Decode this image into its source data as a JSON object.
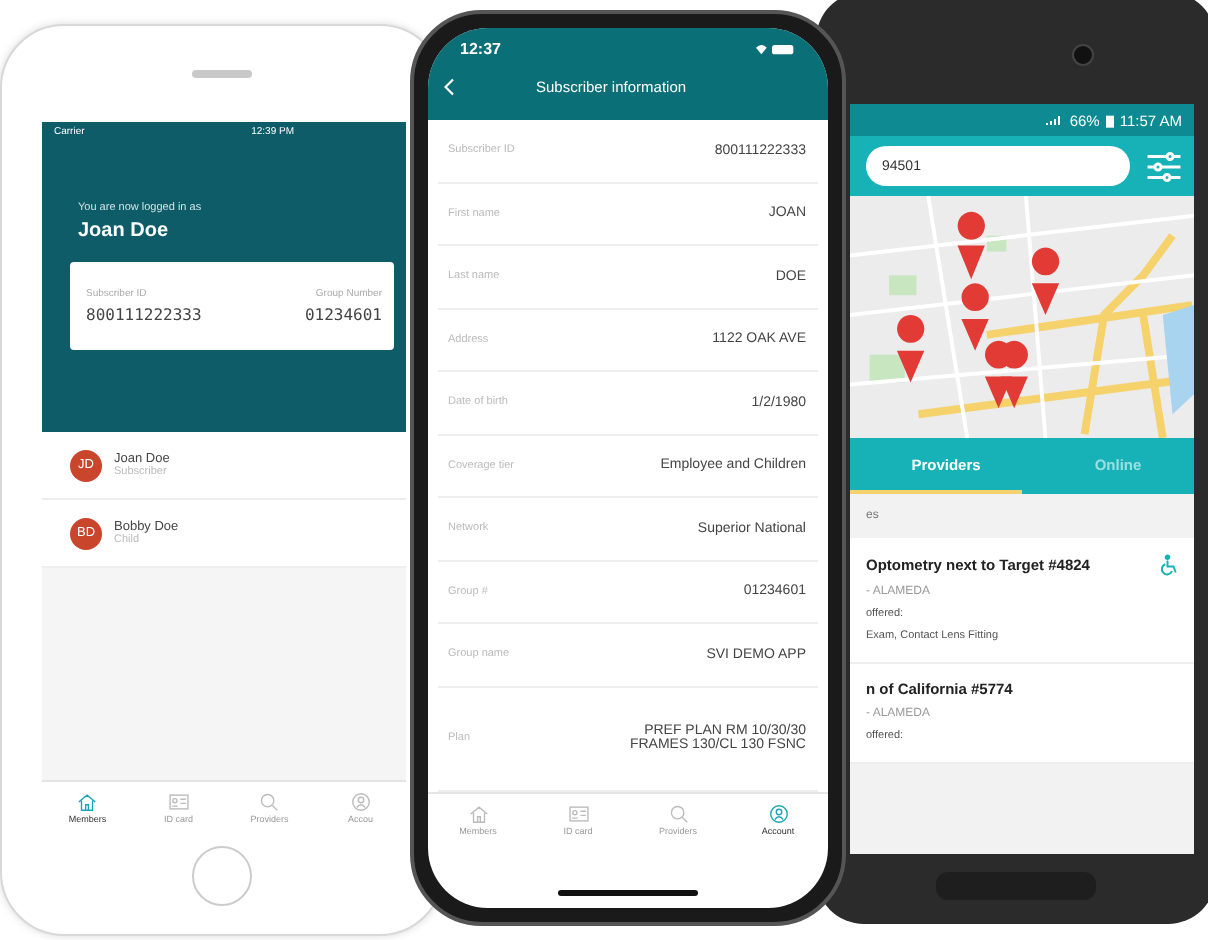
{
  "members_phone": {
    "status_bar": {
      "carrier": "Carrier",
      "time": "12:39 PM"
    },
    "greeting": "You are now logged in as",
    "user_name": "Joan Doe",
    "card_fields": [
      {
        "label": "Subscriber ID",
        "value": "800111222333"
      },
      {
        "label": "Group Number",
        "value": "01234601"
      }
    ],
    "members": [
      {
        "initials": "JD",
        "name": "Joan Doe",
        "role": "Subscriber"
      },
      {
        "initials": "BD",
        "name": "Bobby Doe",
        "role": "Child"
      }
    ],
    "tabs": [
      {
        "kind": "home",
        "label": "Members",
        "selected": true
      },
      {
        "kind": "card",
        "label": "ID card",
        "selected": false
      },
      {
        "kind": "search",
        "label": "Providers",
        "selected": false
      },
      {
        "kind": "account",
        "label": "Accou",
        "selected": false
      }
    ]
  },
  "subscriber_phone": {
    "status_bar": {
      "time": "12:37"
    },
    "title": "Subscriber information",
    "rows": [
      {
        "label": "Subscriber ID",
        "value": "800111222333"
      },
      {
        "label": "First name",
        "value": "JOAN"
      },
      {
        "label": "Last name",
        "value": "DOE"
      },
      {
        "label": "Address",
        "value": "1122 OAK AVE"
      },
      {
        "label": "Date of birth",
        "value": "1/2/1980"
      },
      {
        "label": "Coverage tier",
        "value": "Employee and Children"
      },
      {
        "label": "Network",
        "value": "Superior National"
      },
      {
        "label": "Group #",
        "value": "01234601"
      },
      {
        "label": "Group name",
        "value": "SVI DEMO APP"
      },
      {
        "label": "Plan",
        "value": "PREF PLAN RM 10/30/30 FRAMES 130/CL 130 FSNC"
      }
    ],
    "tabs": [
      {
        "kind": "home",
        "label": "Members",
        "selected": false
      },
      {
        "kind": "card",
        "label": "ID card",
        "selected": false
      },
      {
        "kind": "search",
        "label": "Providers",
        "selected": false
      },
      {
        "kind": "account",
        "label": "Account",
        "selected": true
      }
    ]
  },
  "providers_phone": {
    "status_bar": {
      "battery": "66%",
      "time": "11:57 AM"
    },
    "search": {
      "value": "94501"
    },
    "tabs": [
      {
        "label": "Providers",
        "selected": true
      },
      {
        "label": "Online",
        "selected": false
      }
    ],
    "section": "es",
    "results": [
      {
        "name": "Optometry next to Target #4824",
        "location": "- ALAMEDA",
        "offered_label": "offered:",
        "services": "Exam, Contact Lens Fitting",
        "accessible": true
      },
      {
        "name": "n of California #5774",
        "location": "- ALAMEDA",
        "offered_label": "offered:",
        "accessible": false
      }
    ]
  }
}
